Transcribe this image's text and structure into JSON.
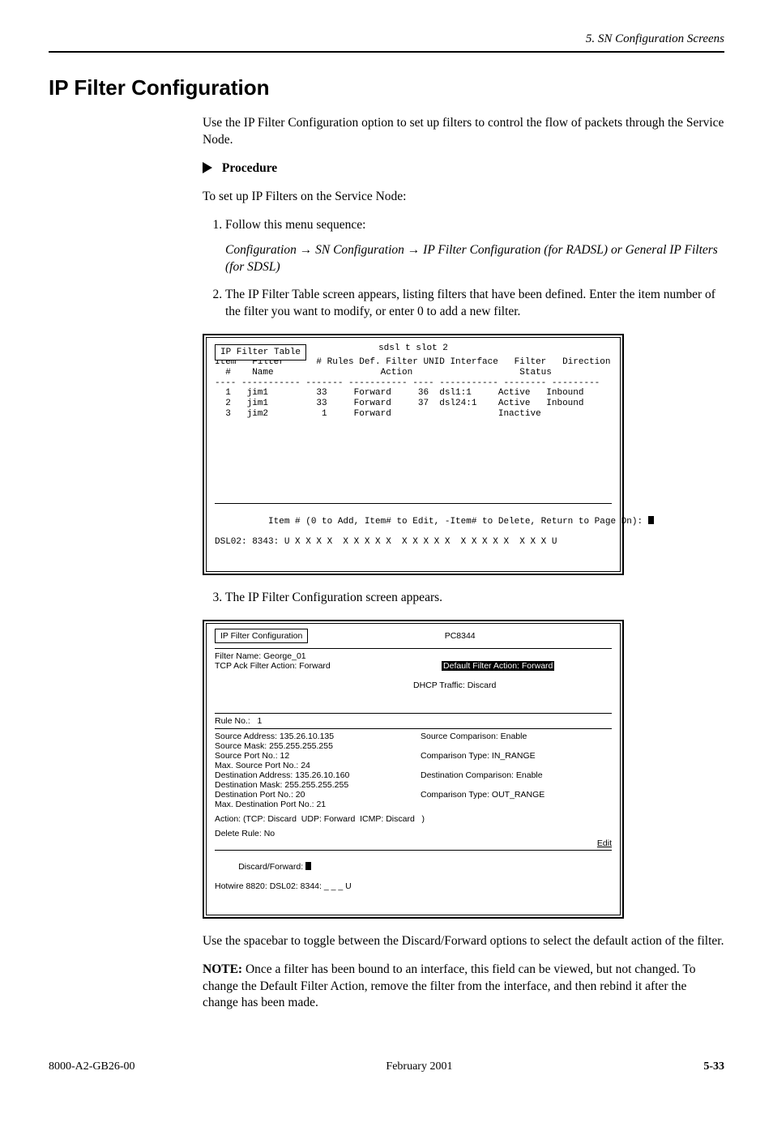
{
  "running_head": "5. SN Configuration Screens",
  "section_title": "IP Filter Configuration",
  "intro": "Use the IP Filter Configuration option to set up filters to control the flow of packets through the Service Node.",
  "proc_title": "Procedure",
  "proc_intro": "To set up IP Filters on the Service Node:",
  "steps": {
    "s1_pre": "Follow this menu sequence:",
    "s1_seq_prefix": "Configuration",
    "s1_seq_rest": " → SN Configuration → IP Filter Configuration (for RADSL) or General IP Filters (for SDSL)",
    "s2": "The IP Filter Table screen appears, listing filters that have been defined. Enter the item number of the filter you want to modify, or enter 0 to add a new filter.",
    "s3": "The IP Filter Configuration screen appears."
  },
  "screen1": {
    "tab": "IP Filter Table",
    "title_right": "sdsl t slot 2",
    "headers": "Item   Filter      # Rules Def. Filter UNID Interface   Filter   Direction\n  #    Name                    Action                    Status\n---- ----------- ------- ----------- ---- ----------- -------- ---------",
    "rows": "  1   jim1         33     Forward     36  dsl1:1     Active   Inbound\n  2   jim1         33     Forward     37  dsl24:1    Active   Inbound\n  3   jim2          1     Forward                    Inactive",
    "prompt": "Item # (0 to Add, Item# to Edit, -Item# to Delete, Return to Page Dn): ",
    "status": "DSL02: 8343: U X X X X  X X X X X  X X X X X  X X X X X  X X X U"
  },
  "screen2": {
    "tab": "IP Filter Configuration",
    "title_right": "PC8344",
    "top_left": "Filter Name: George_01\nTCP Ack Filter Action: Forward",
    "top_right_inv": "Default Filter Action: Forward",
    "top_right_line2": "DHCP Traffic: Discard",
    "rule_line": "Rule No.:   1",
    "left_block": "Source Address: 135.26.10.135\nSource Mask: 255.255.255.255\nSource Port No.: 12\nMax. Source Port No.: 24\nDestination Address: 135.26.10.160\nDestination Mask: 255.255.255.255\nDestination Port No.: 20\nMax. Destination Port No.: 21",
    "right_block": "Source Comparison: Enable\n\nComparison Type: IN_RANGE\n\nDestination Comparison: Enable\n\nComparison Type: OUT_RANGE",
    "action_line": "Action: (TCP: Discard  UDP: Forward  ICMP: Discard   )",
    "delete_line": "Delete Rule: No",
    "edit_label": "Edit",
    "prompt": "Discard/Forward: ",
    "status": "Hotwire 8820: DSL02: 8344: _ _ _ U"
  },
  "after_screens": {
    "p1": "Use the spacebar to toggle between the Discard/Forward options to select the default action of the filter.",
    "p2_prefix": "NOTE:",
    "p2_rest": "  Once a filter has been bound to an interface, this field can be viewed, but not changed. To change the Default Filter Action, remove the filter from the interface, and then rebind it after the change has been made."
  },
  "footer": {
    "docnum": "8000-A2-GB26-00",
    "month": "February 2001",
    "pgnum": "5-33"
  }
}
